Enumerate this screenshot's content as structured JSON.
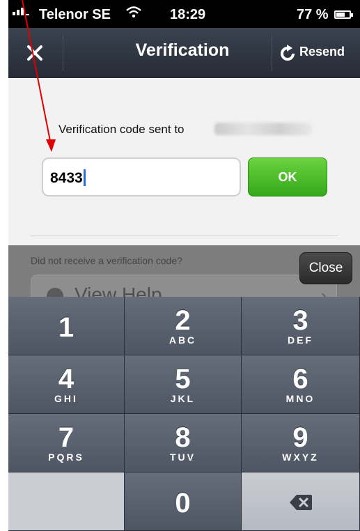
{
  "status_bar": {
    "carrier": "Telenor SE",
    "time": "18:29",
    "battery": "77 %",
    "battery_level": 0.77,
    "wifi_icon": "wifi-icon"
  },
  "nav": {
    "title": "Verification",
    "resend_label": "Resend",
    "close_icon": "close-icon",
    "resend_icon": "refresh-icon"
  },
  "verification": {
    "sent_label": "Verification code sent to",
    "code_value": "8433",
    "ok_label": "OK"
  },
  "help": {
    "prompt": "Did not receive a verification code?",
    "view_help_label": "View Help",
    "close_label": "Close"
  },
  "keypad": {
    "keys": [
      {
        "digit": "1",
        "letters": ""
      },
      {
        "digit": "2",
        "letters": "ABC"
      },
      {
        "digit": "3",
        "letters": "DEF"
      },
      {
        "digit": "4",
        "letters": "GHI"
      },
      {
        "digit": "5",
        "letters": "JKL"
      },
      {
        "digit": "6",
        "letters": "MNO"
      },
      {
        "digit": "7",
        "letters": "PQRS"
      },
      {
        "digit": "8",
        "letters": "TUV"
      },
      {
        "digit": "9",
        "letters": "WXYZ"
      },
      {
        "digit": "",
        "letters": ""
      },
      {
        "digit": "0",
        "letters": ""
      },
      {
        "digit": "",
        "letters": ""
      }
    ],
    "delete_icon": "backspace-icon"
  },
  "colors": {
    "ok_green": "#4bbf2a",
    "annotation_red": "#e00000",
    "nav_bg": "#2d3440",
    "keypad_bg": "#565d6b"
  }
}
